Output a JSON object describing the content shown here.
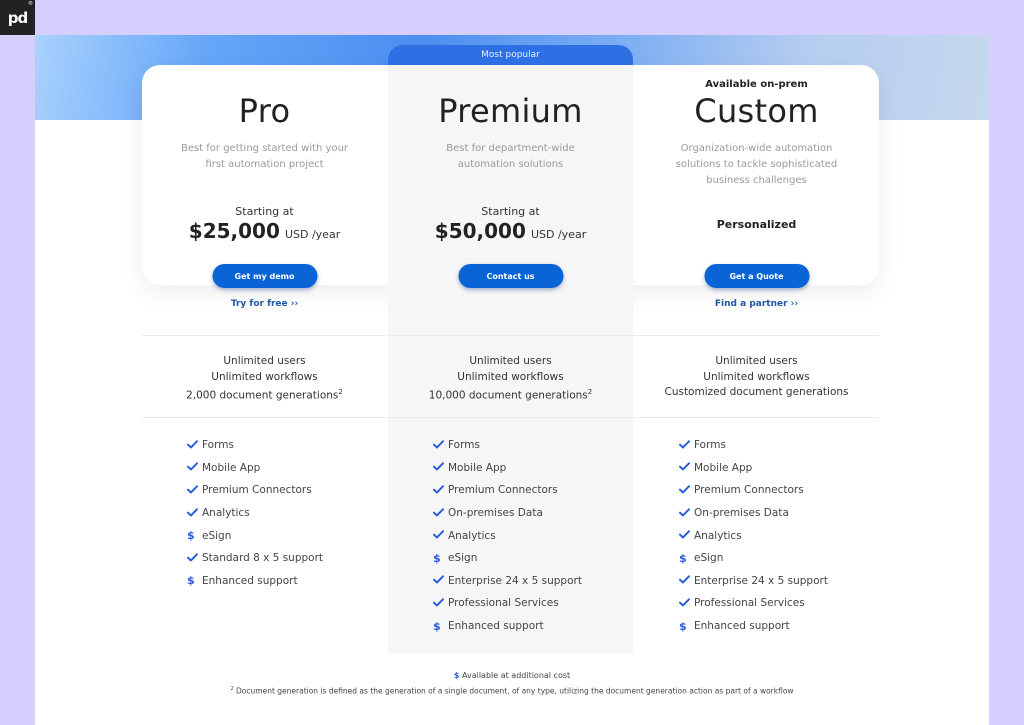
{
  "logo": {
    "text": "pd",
    "registered": "®"
  },
  "legend": {
    "dollar_symbol": "$",
    "additional_cost": "Available at additional cost",
    "footnote_mark": "2",
    "footnote_text": "Document generation is defined as the generation of a single document, of any type, utilizing the document generation action as part of a workflow"
  },
  "colors": {
    "accent": "#0a64d6",
    "popular_banner": "#2f6fe4",
    "link": "#1f56a6",
    "icon": "#2a5ed6",
    "page_bg": "#d6cffe"
  },
  "plans": [
    {
      "name": "Pro",
      "description": "Best for getting started with your first automation project",
      "starting_label": "Starting at",
      "price": "$25,000",
      "price_unit": "USD /year",
      "button_label": "Get my demo",
      "link_label": "Try for free ››",
      "summary": [
        "Unlimited users",
        "Unlimited workflows",
        "2,000 document generations"
      ],
      "summary_footnote": "2",
      "features": [
        {
          "icon": "check-icon",
          "label": "Forms"
        },
        {
          "icon": "check-icon",
          "label": "Mobile App"
        },
        {
          "icon": "check-icon",
          "label": "Premium Connectors"
        },
        {
          "icon": "check-icon",
          "label": "Analytics"
        },
        {
          "icon": "dollar-icon",
          "label": "eSign"
        },
        {
          "icon": "check-icon",
          "label": "Standard 8 x 5 support"
        },
        {
          "icon": "dollar-icon",
          "label": "Enhanced support"
        }
      ]
    },
    {
      "name": "Premium",
      "badge": "Most popular",
      "description": "Best for department-wide automation solutions",
      "starting_label": "Starting at",
      "price": "$50,000",
      "price_unit": "USD /year",
      "button_label": "Contact us",
      "summary": [
        "Unlimited users",
        "Unlimited workflows",
        "10,000 document generations"
      ],
      "summary_footnote": "2",
      "features": [
        {
          "icon": "check-icon",
          "label": "Forms"
        },
        {
          "icon": "check-icon",
          "label": "Mobile App"
        },
        {
          "icon": "check-icon",
          "label": "Premium Connectors"
        },
        {
          "icon": "check-icon",
          "label": "On-premises Data"
        },
        {
          "icon": "check-icon",
          "label": "Analytics"
        },
        {
          "icon": "dollar-icon",
          "label": "eSign"
        },
        {
          "icon": "check-icon",
          "label": "Enterprise 24 x 5 support"
        },
        {
          "icon": "check-icon",
          "label": "Professional Services"
        },
        {
          "icon": "dollar-icon",
          "label": "Enhanced support"
        }
      ]
    },
    {
      "name": "Custom",
      "tagline": "Available on-prem",
      "description": "Organization-wide automation solutions to tackle sophisticated business challenges",
      "price_label": "Personalized",
      "button_label": "Get a Quote",
      "link_label": "Find a partner ››",
      "summary": [
        "Unlimited users",
        "Unlimited workflows",
        "Customized document generations"
      ],
      "features": [
        {
          "icon": "check-icon",
          "label": "Forms"
        },
        {
          "icon": "check-icon",
          "label": "Mobile App"
        },
        {
          "icon": "check-icon",
          "label": "Premium Connectors"
        },
        {
          "icon": "check-icon",
          "label": "On-premises Data"
        },
        {
          "icon": "check-icon",
          "label": "Analytics"
        },
        {
          "icon": "dollar-icon",
          "label": "eSign"
        },
        {
          "icon": "check-icon",
          "label": "Enterprise 24 x 5 support"
        },
        {
          "icon": "check-icon",
          "label": "Professional Services"
        },
        {
          "icon": "dollar-icon",
          "label": "Enhanced support"
        }
      ]
    }
  ]
}
